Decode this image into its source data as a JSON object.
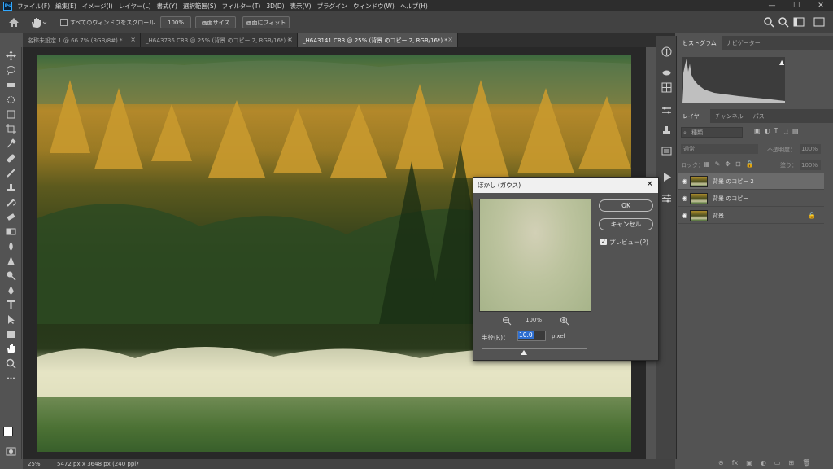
{
  "app": {
    "logo": "Ps"
  },
  "menu": [
    "ファイル(F)",
    "編集(E)",
    "イメージ(I)",
    "レイヤー(L)",
    "書式(Y)",
    "選択範囲(S)",
    "フィルター(T)",
    "3D(D)",
    "表示(V)",
    "プラグイン",
    "ウィンドウ(W)",
    "ヘルプ(H)"
  ],
  "window_controls": {
    "minimize": "—",
    "maximize": "☐",
    "close": "✕"
  },
  "options": {
    "scroll_all_label": "すべてのウィンドウをスクロール",
    "zoom_100": "100%",
    "fit_screen": "画面サイズ",
    "fill_screen": "画面にフィット"
  },
  "tabs": [
    {
      "label": "名称未設定 1 @ 66.7% (RGB/8#) *",
      "close": "×"
    },
    {
      "label": "_H6A3736.CR3 @ 25% (背景 のコピー 2, RGB/16*) *",
      "close": "×"
    },
    {
      "label": "_H6A3141.CR3 @ 25% (背景 のコピー 2, RGB/16*) *",
      "close": "×"
    }
  ],
  "status": {
    "zoom": "25%",
    "doc_info": "5472 px x 3648 px (240 ppi)",
    "arrow": "›"
  },
  "panels": {
    "top_tabs": [
      "ヒストグラム",
      "ナビゲーター"
    ],
    "layer_tabs": [
      "レイヤー",
      "チャンネル",
      "パス"
    ],
    "search_placeholder": "種類",
    "blend_mode": "通常",
    "opacity_label": "不透明度：",
    "opacity_value": "100%",
    "lock_label": "ロック：",
    "fill_label": "塗り：",
    "fill_value": "100%",
    "layers": [
      {
        "name": "背景 のコピー 2",
        "selected": true
      },
      {
        "name": "背景 のコピー",
        "selected": false
      },
      {
        "name": "背景",
        "selected": false,
        "locked": true
      }
    ]
  },
  "dialog": {
    "title": "ぼかし (ガウス)",
    "close": "✕",
    "ok": "OK",
    "cancel": "キャンセル",
    "preview_label": "プレビュー(P)",
    "preview_checked": true,
    "zoom_percent": "100%",
    "radius_label": "半径(R)：",
    "radius_value": "10.0",
    "radius_unit": "pixel"
  }
}
